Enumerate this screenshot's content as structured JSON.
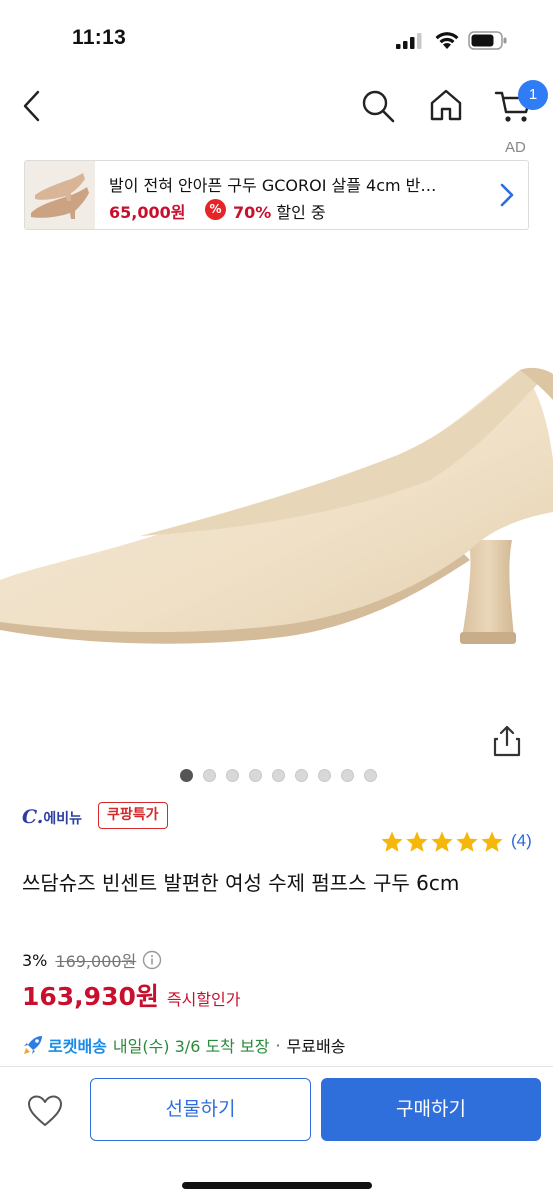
{
  "status_bar": {
    "time": "11:13",
    "icons": [
      "signal-icon",
      "wifi-icon",
      "battery-icon"
    ]
  },
  "nav": {
    "icons": [
      "back-icon",
      "search-icon",
      "home-icon",
      "cart-icon"
    ],
    "cart_count": "1",
    "ad_label": "AD"
  },
  "ad_banner": {
    "title": "발이 전혀 안아픈 구두 GCOROI 살플 4cm 반…",
    "price": "65,000원",
    "discount_icon": "%",
    "discount_pct": "70%",
    "discount_suffix": " 할인 중"
  },
  "gallery": {
    "dot_count": 9,
    "active_index": 0
  },
  "product": {
    "brand_c": "C.",
    "brand_name": "에비뉴",
    "deal_badge": "쿠팡특가",
    "rating": 5,
    "review_count": "(4)",
    "title": "쓰담슈즈 빈센트 발편한 여성 수제 펌프스 구두 6cm",
    "discount_rate": "3%",
    "original_price": "169,000원",
    "sale_price": "163,930원",
    "sale_label": "즉시할인가"
  },
  "delivery": {
    "rocket_label": "로켓배송",
    "arrival": "내일(수) 3/6 도착 보장",
    "separator": "·",
    "shipping": "무료배송"
  },
  "bottom_bar": {
    "gift_label": "선물하기",
    "buy_label": "구매하기"
  },
  "colors": {
    "accent_blue": "#2f6fdc",
    "price_red": "#c8102e",
    "star_yellow": "#f5b70a",
    "delivery_green": "#2a8a3b"
  }
}
